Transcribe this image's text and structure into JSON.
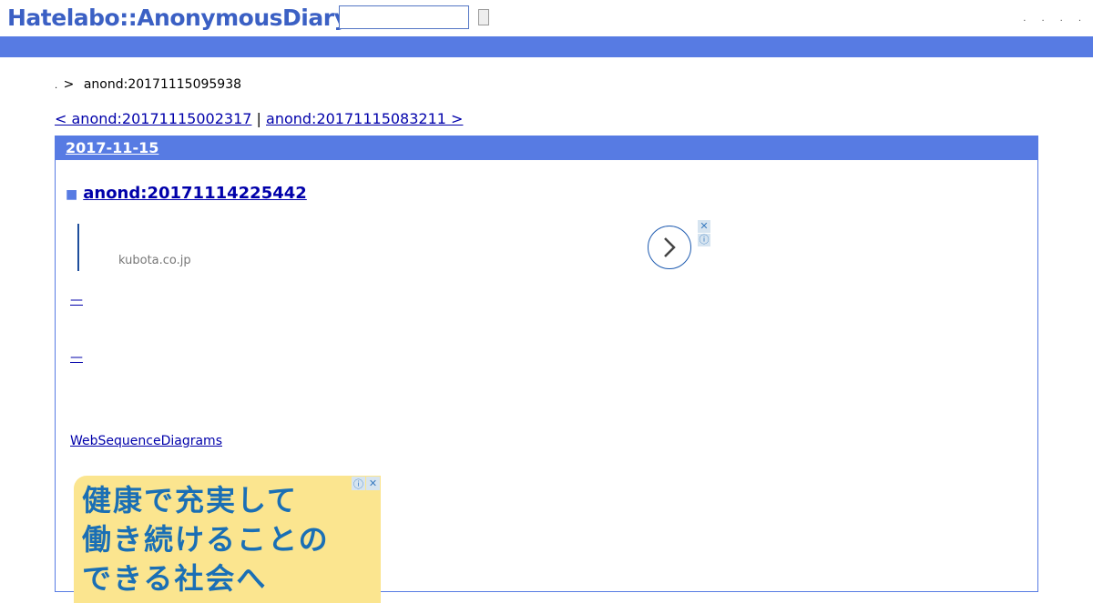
{
  "header": {
    "logo": "Hatelabo::AnonymousDiary",
    "search_placeholder": "",
    "links": [
      ".",
      ".",
      ".",
      "."
    ]
  },
  "breadcrumb": {
    "home": ".",
    "separator": ">",
    "current": "anond:20171115095938"
  },
  "pager": {
    "prev": "< anond:20171115002317",
    "divider": "|",
    "next": "anond:20171115083211 >"
  },
  "day": {
    "date": "2017-11-15",
    "entry_marker": "■",
    "entry_title": "anond:20171114225442"
  },
  "ad": {
    "domain": "kubota.co.jp",
    "close": "✕",
    "info": "ⓘ",
    "arrow": "›"
  },
  "content": {
    "dash1": "—",
    "dash2": "—",
    "wsd_link": "WebSequenceDiagrams"
  },
  "ad_banner": {
    "text": "健康で充実して\n働き続けることの\nできる社会へ"
  },
  "colors": {
    "brand_blue": "#577be3",
    "logo_blue": "#3b60c4",
    "link": "#0000aa",
    "ad_yellow": "#fbe58f"
  }
}
